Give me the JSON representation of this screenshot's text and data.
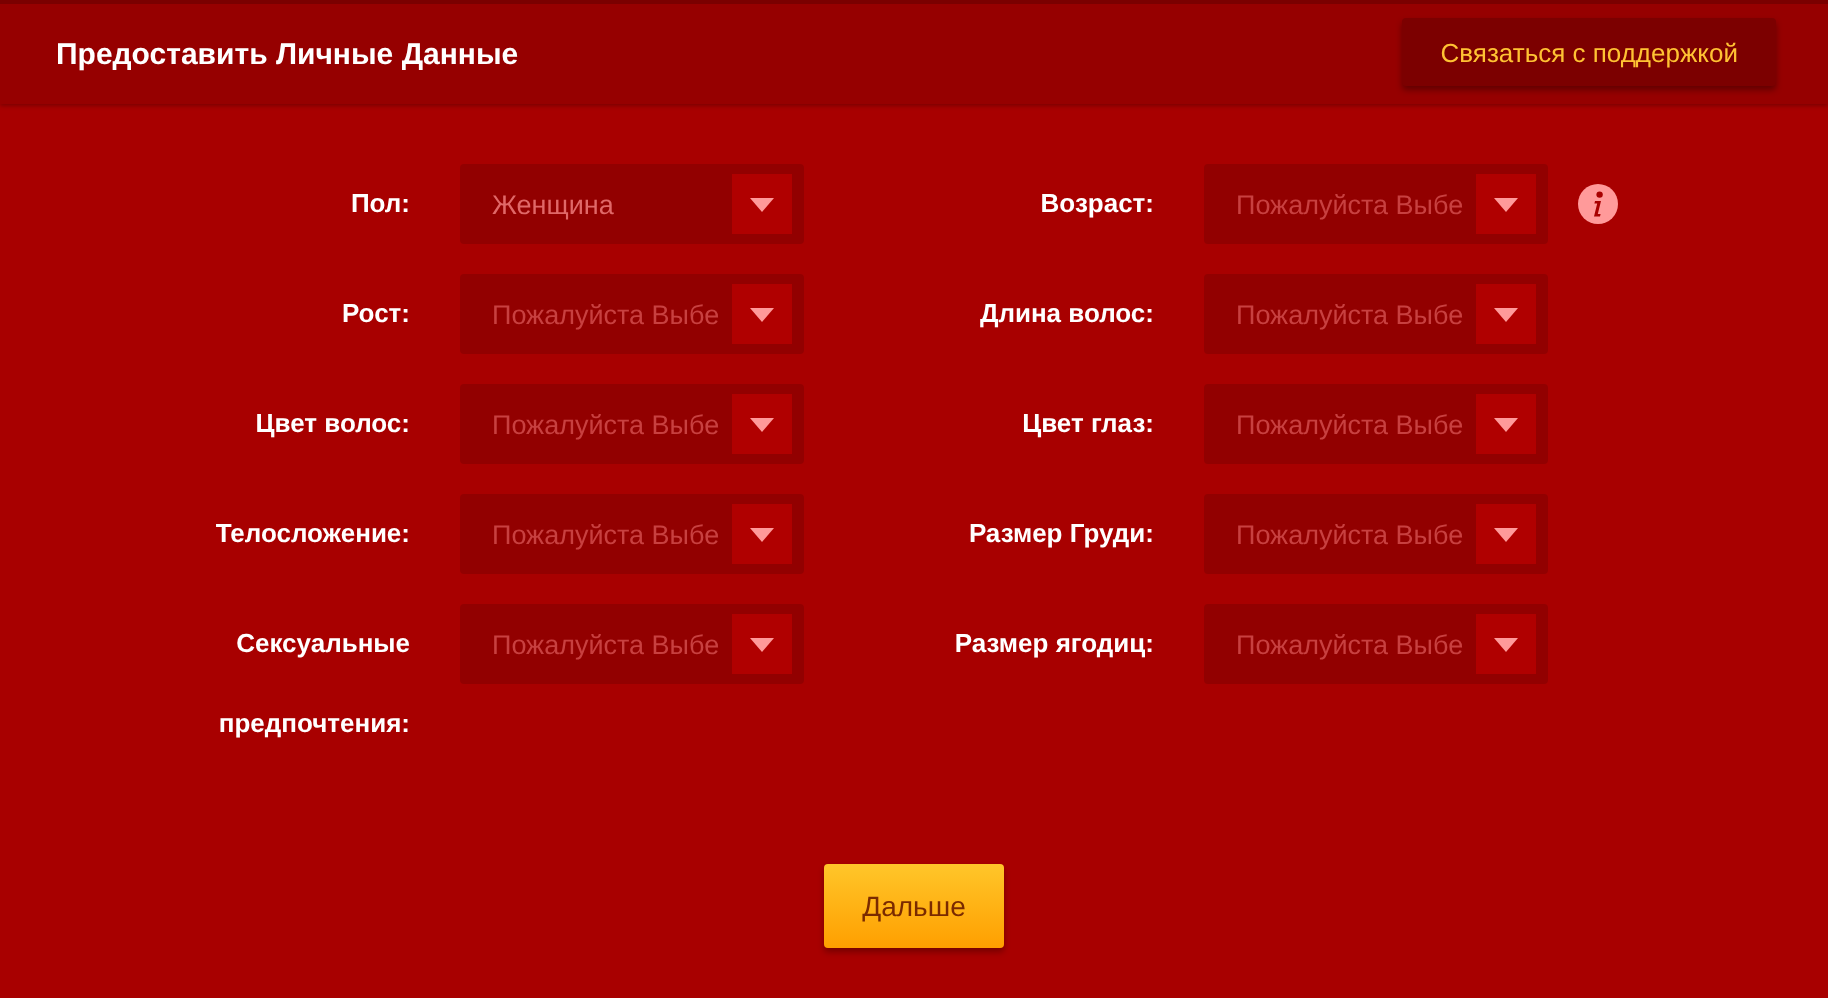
{
  "header": {
    "title": "Предоставить Личные Данные",
    "support_button": "Связаться с поддержкой"
  },
  "rows": [
    {
      "fields": [
        {
          "label": "Пол:",
          "value": "Женщина",
          "info": false
        },
        {
          "label": "Возраст:",
          "placeholder": "Пожалуйста Выбе",
          "info": true
        }
      ]
    },
    {
      "fields": [
        {
          "label": "Рост:",
          "placeholder": "Пожалуйста Выбе",
          "info": false
        },
        {
          "label": "Длина волос:",
          "placeholder": "Пожалуйста Выбе",
          "info": false
        }
      ]
    },
    {
      "fields": [
        {
          "label": "Цвет волос:",
          "placeholder": "Пожалуйста Выбе",
          "info": false
        },
        {
          "label": "Цвет глаз:",
          "placeholder": "Пожалуйста Выбе",
          "info": false
        }
      ]
    },
    {
      "fields": [
        {
          "label": "Телосложение:",
          "placeholder": "Пожалуйста Выбе",
          "info": false
        },
        {
          "label": "Размер Груди:",
          "placeholder": "Пожалуйста Выбе",
          "info": false
        }
      ]
    },
    {
      "fields": [
        {
          "label": "Сексуальные предпочтения:",
          "placeholder": "Пожалуйста Выбе",
          "info": false
        },
        {
          "label": "Размер ягодиц:",
          "placeholder": "Пожалуйста Выбе",
          "info": false
        }
      ]
    }
  ],
  "next_button": "Дальше"
}
